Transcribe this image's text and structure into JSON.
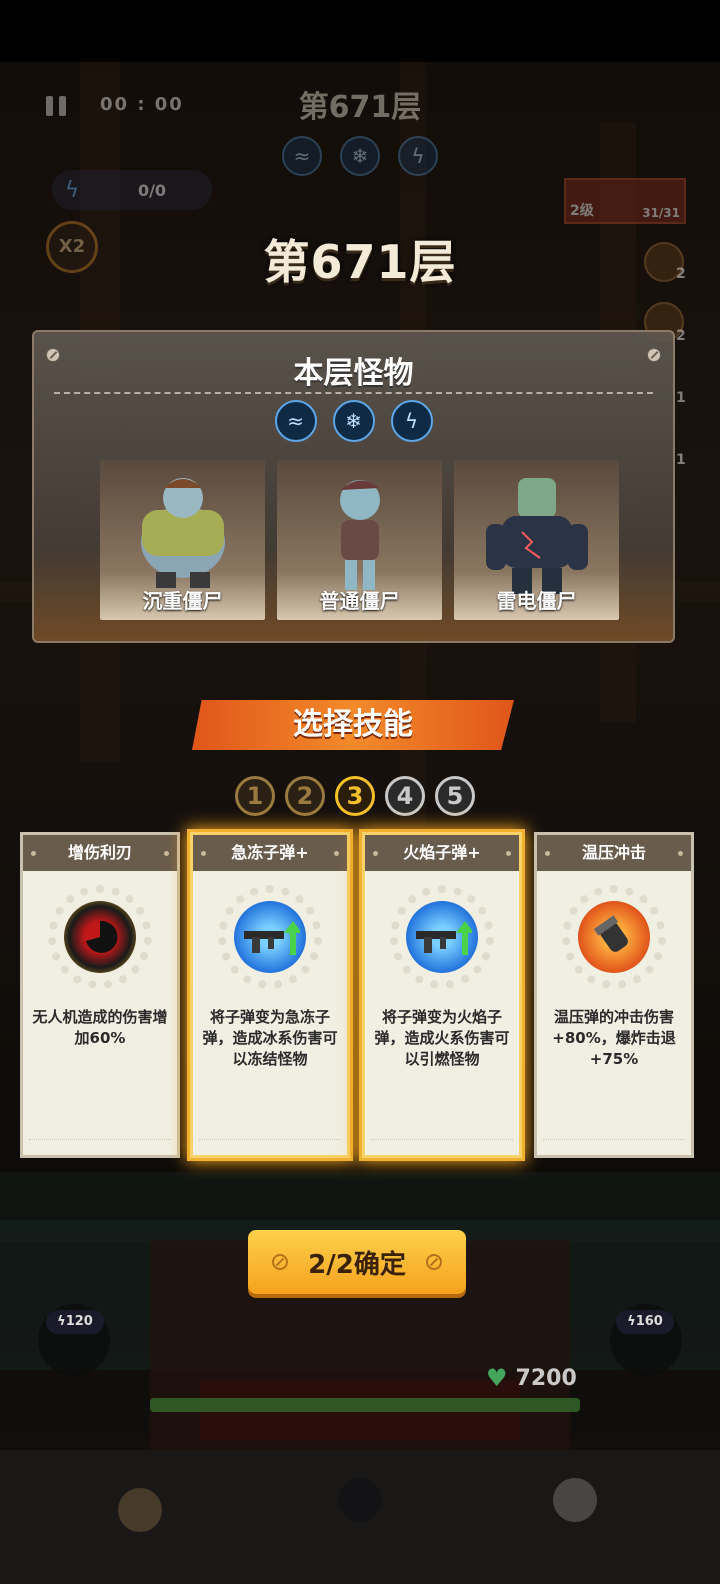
{
  "hud": {
    "timer": "00 : 00",
    "floor_label": "第671层",
    "energy": "0/0",
    "speed": "X2",
    "weapon_level": "2级",
    "weapon_count": "31/31",
    "side_counts": [
      "2",
      "2",
      "1",
      "1"
    ],
    "left_energy": "120",
    "right_energy": "160",
    "hp": "7200"
  },
  "floor_title": "第671层",
  "monster_panel": {
    "title": "本层怪物",
    "element_icons": [
      "wind-icon",
      "ice-icon",
      "lightning-icon"
    ],
    "monsters": [
      {
        "name": "沉重僵尸",
        "icon": "heavy-zombie"
      },
      {
        "name": "普通僵尸",
        "icon": "normal-zombie"
      },
      {
        "name": "雷电僵尸",
        "icon": "electric-zombie"
      }
    ]
  },
  "skill_select": {
    "title": "选择技能",
    "steps": [
      "1",
      "2",
      "3",
      "4",
      "5"
    ],
    "current_step": 3,
    "cards": [
      {
        "name": "增伤利刃",
        "desc": "无人机造成的伤害增加60%",
        "icon": "blade-icon",
        "selected": false
      },
      {
        "name": "急冻子弹+",
        "desc": "将子弹变为急冻子弹，造成冰系伤害可以冻结怪物",
        "icon": "rifle-upgrade-icon",
        "selected": true
      },
      {
        "name": "火焰子弹+",
        "desc": "将子弹变为火焰子弹，造成火系伤害可以引燃怪物",
        "icon": "rifle-upgrade-icon",
        "selected": true
      },
      {
        "name": "温压冲击",
        "desc": "温压弹的冲击伤害+80%，爆炸击退+75%",
        "icon": "thermobaric-shell-icon",
        "selected": false
      }
    ],
    "confirm_label": "2/2确定"
  },
  "colors": {
    "accent_orange": "#f38a2a",
    "confirm_yellow": "#ffd04a",
    "selected_glow": "#f0b030",
    "current_step": "#f5c02a"
  }
}
